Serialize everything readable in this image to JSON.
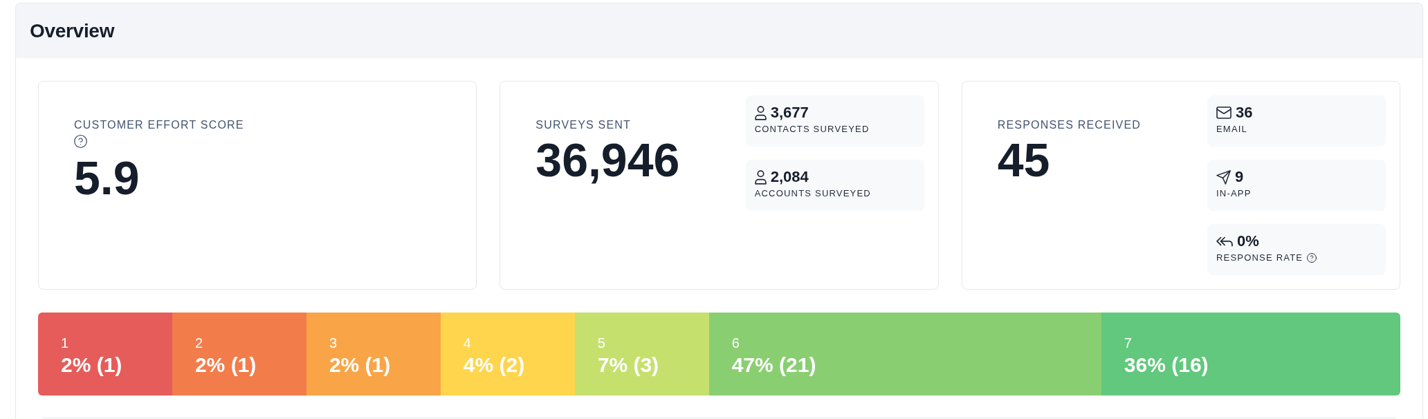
{
  "panel": {
    "title": "Overview"
  },
  "cards": [
    {
      "label": "CUSTOMER EFFORT SCORE",
      "help": true,
      "value": "5.9"
    },
    {
      "label": "SURVEYS SENT",
      "help": false,
      "value": "36,946",
      "details": [
        {
          "kind": "contacts",
          "value": "3,677",
          "label": "CONTACTS SURVEYED",
          "help": false
        },
        {
          "kind": "accounts",
          "value": "2,084",
          "label": "ACCOUNTS SURVEYED",
          "help": false
        }
      ]
    },
    {
      "label": "RESPONSES RECEIVED",
      "help": false,
      "value": "45",
      "details": [
        {
          "kind": "email",
          "value": "36",
          "label": "EMAIL",
          "help": false
        },
        {
          "kind": "in_app",
          "value": "9",
          "label": "IN-APP",
          "help": false
        },
        {
          "kind": "rate",
          "value": "0%",
          "label": "RESPONSE RATE",
          "help": true
        }
      ]
    }
  ],
  "scale": {
    "segments": [
      {
        "score": "1",
        "share": "2% (1)",
        "color": "#e55c5a"
      },
      {
        "score": "2",
        "share": "2% (1)",
        "color": "#f37c4b"
      },
      {
        "score": "3",
        "share": "2% (1)",
        "color": "#f9a547"
      },
      {
        "score": "4",
        "share": "4% (2)",
        "color": "#fed54c"
      },
      {
        "score": "5",
        "share": "7% (3)",
        "color": "#c6e06e"
      },
      {
        "score": "6",
        "share": "47% (21)",
        "color": "#8ace72"
      },
      {
        "score": "7",
        "share": "36% (16)",
        "color": "#61c87d"
      }
    ]
  }
}
